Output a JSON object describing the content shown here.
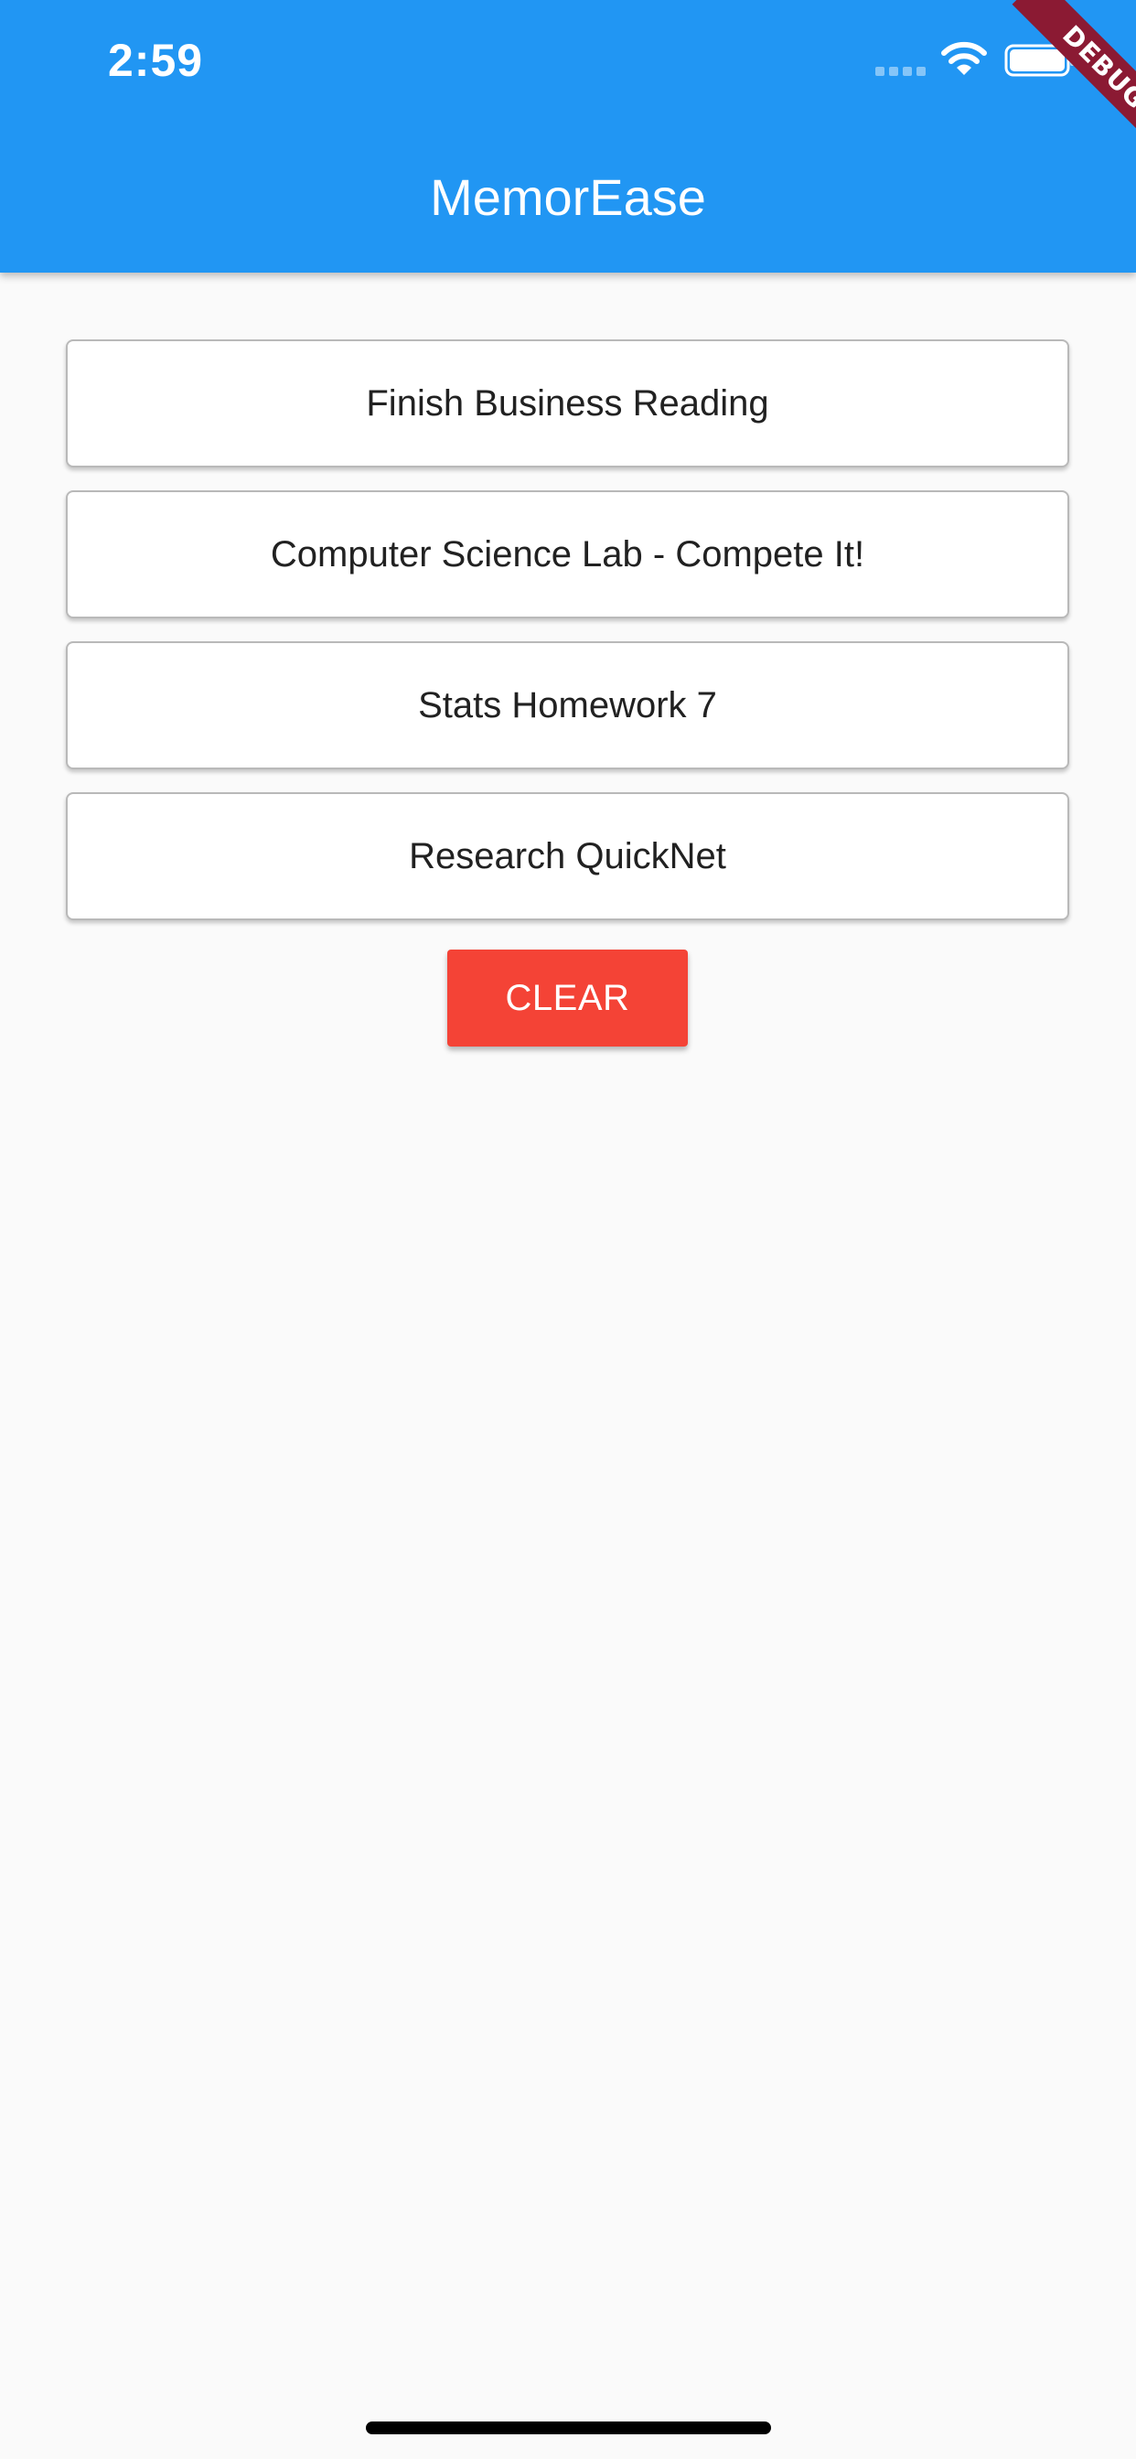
{
  "status_bar": {
    "time": "2:59",
    "icons": [
      "cellular-signal-icon",
      "wifi-icon",
      "battery-icon"
    ]
  },
  "app_bar": {
    "title": "MemorEase",
    "background_color": "#2196f3"
  },
  "debug_banner": {
    "label": "DEBUG",
    "color": "#8b1a33"
  },
  "tasks": [
    {
      "label": "Finish Business Reading"
    },
    {
      "label": "Computer Science Lab - Compete It!"
    },
    {
      "label": "Stats Homework 7"
    },
    {
      "label": "Research QuickNet"
    }
  ],
  "clear_button": {
    "label": "CLEAR",
    "color": "#f44336"
  }
}
